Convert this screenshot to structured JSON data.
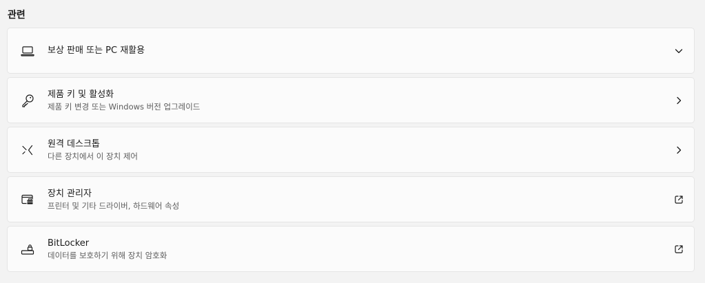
{
  "section": {
    "title": "관련"
  },
  "items": [
    {
      "title": "보상 판매 또는 PC 재활용",
      "subtitle": "",
      "icon": "laptop-icon",
      "trailing_icon": "chevron-down-icon"
    },
    {
      "title": "제품 키 및 활성화",
      "subtitle": "제품 키 변경 또는 Windows 버전 업그레이드",
      "icon": "key-icon",
      "trailing_icon": "chevron-right-icon"
    },
    {
      "title": "원격 데스크톱",
      "subtitle": "다른 장치에서 이 장치 제어",
      "icon": "remote-desktop-icon",
      "trailing_icon": "chevron-right-icon"
    },
    {
      "title": "장치 관리자",
      "subtitle": "프린터 및 기타 드라이버, 하드웨어 속성",
      "icon": "device-manager-icon",
      "trailing_icon": "open-external-icon"
    },
    {
      "title": "BitLocker",
      "subtitle": "데이터를 보호하기 위해 장치 암호화",
      "icon": "bitlocker-icon",
      "trailing_icon": "open-external-icon"
    }
  ]
}
